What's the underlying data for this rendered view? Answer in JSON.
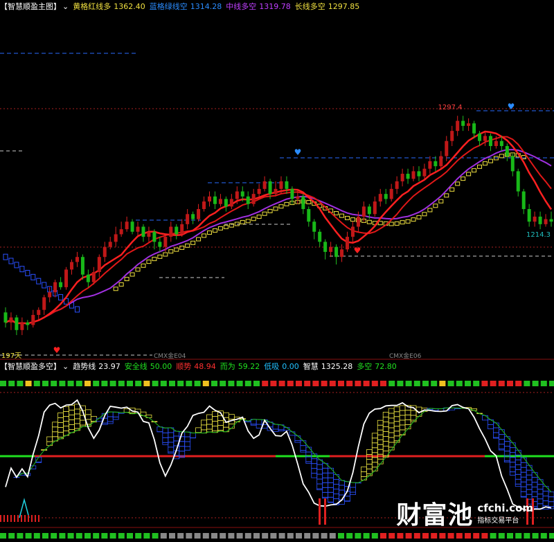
{
  "main_panel": {
    "title": "【智慧顺盈主图】",
    "dropdown_glyph": "⌄",
    "indicators": [
      {
        "label": "黄格红线多",
        "value": "1362.40",
        "color": "#f0e040"
      },
      {
        "label": "蓝格绿线空",
        "value": "1314.28",
        "color": "#2a8cff"
      },
      {
        "label": "中线多空",
        "value": "1319.78",
        "color": "#c040ff"
      },
      {
        "label": "长线多空",
        "value": "1297.85",
        "color": "#f0e040"
      }
    ],
    "labels": {
      "high": "1297.4",
      "low": "1214.3",
      "period": "197天",
      "contract_a": "CMX金E04",
      "contract_b": "CMX金E06"
    }
  },
  "sub_panel": {
    "title": "【智慧顺盈多空】",
    "dropdown_glyph": "⌄",
    "indicators": [
      {
        "label": "趋势线",
        "value": "23.97",
        "color": "#ffffff"
      },
      {
        "label": "安全线",
        "value": "50.00",
        "color": "#20e020"
      },
      {
        "label": "顺势",
        "value": "48.94",
        "color": "#ff3030"
      },
      {
        "label": "而为",
        "value": "59.22",
        "color": "#20e020"
      },
      {
        "label": "低吸",
        "value": "0.00",
        "color": "#20c0ff"
      },
      {
        "label": "智慧",
        "value": "1325.28",
        "color": "#ffffff"
      },
      {
        "label": "多空",
        "value": "72.80",
        "color": "#20e020"
      }
    ]
  },
  "watermark": {
    "brand": "财富池",
    "domain": "cfchi.com",
    "tagline": "指标交易平台"
  },
  "chart_data": {
    "type": "candlestick",
    "y_label_points": {
      "high": 1297.4,
      "low": 1214.3
    },
    "candles": [
      [
        1240,
        1236,
        1242,
        1234
      ],
      [
        1236,
        1238,
        1240,
        1233
      ],
      [
        1238,
        1233,
        1239,
        1231
      ],
      [
        1233,
        1236,
        1238,
        1231
      ],
      [
        1236,
        1235,
        1237,
        1233
      ],
      [
        1235,
        1239,
        1241,
        1234
      ],
      [
        1239,
        1241,
        1242,
        1237
      ],
      [
        1241,
        1246,
        1247,
        1239
      ],
      [
        1246,
        1248,
        1250,
        1244
      ],
      [
        1248,
        1252,
        1253,
        1246
      ],
      [
        1252,
        1250,
        1254,
        1249
      ],
      [
        1250,
        1257,
        1258,
        1249
      ],
      [
        1257,
        1260,
        1261,
        1255
      ],
      [
        1260,
        1262,
        1264,
        1258
      ],
      [
        1262,
        1255,
        1263,
        1253
      ],
      [
        1255,
        1252,
        1257,
        1250
      ],
      [
        1252,
        1256,
        1258,
        1251
      ],
      [
        1256,
        1262,
        1263,
        1254
      ],
      [
        1262,
        1266,
        1268,
        1260
      ],
      [
        1266,
        1268,
        1270,
        1265
      ],
      [
        1268,
        1271,
        1274,
        1266
      ],
      [
        1271,
        1273,
        1276,
        1270
      ],
      [
        1273,
        1276,
        1278,
        1272
      ],
      [
        1276,
        1272,
        1277,
        1271
      ],
      [
        1272,
        1274,
        1276,
        1270
      ],
      [
        1274,
        1270,
        1275,
        1268
      ],
      [
        1270,
        1272,
        1274,
        1268
      ],
      [
        1272,
        1268,
        1273,
        1265
      ],
      [
        1268,
        1266,
        1270,
        1264
      ],
      [
        1266,
        1270,
        1271,
        1264
      ],
      [
        1270,
        1274,
        1276,
        1268
      ],
      [
        1274,
        1271,
        1275,
        1269
      ],
      [
        1271,
        1275,
        1277,
        1270
      ],
      [
        1275,
        1279,
        1281,
        1273
      ],
      [
        1279,
        1277,
        1280,
        1275
      ],
      [
        1277,
        1281,
        1283,
        1276
      ],
      [
        1281,
        1284,
        1286,
        1280
      ],
      [
        1284,
        1286,
        1288,
        1282
      ],
      [
        1286,
        1283,
        1288,
        1281
      ],
      [
        1283,
        1285,
        1287,
        1282
      ],
      [
        1285,
        1282,
        1286,
        1280
      ],
      [
        1282,
        1285,
        1287,
        1281
      ],
      [
        1285,
        1288,
        1290,
        1283
      ],
      [
        1288,
        1286,
        1290,
        1284
      ],
      [
        1286,
        1283,
        1288,
        1281
      ],
      [
        1283,
        1287,
        1289,
        1282
      ],
      [
        1287,
        1289,
        1291,
        1286
      ],
      [
        1289,
        1292,
        1294,
        1288
      ],
      [
        1292,
        1287,
        1293,
        1285
      ],
      [
        1287,
        1289,
        1292,
        1286
      ],
      [
        1289,
        1292,
        1294,
        1287
      ],
      [
        1292,
        1289,
        1294,
        1287
      ],
      [
        1289,
        1285,
        1290,
        1283
      ],
      [
        1285,
        1286,
        1289,
        1283
      ],
      [
        1286,
        1281,
        1287,
        1279
      ],
      [
        1281,
        1276,
        1282,
        1274
      ],
      [
        1276,
        1272,
        1277,
        1269
      ],
      [
        1272,
        1268,
        1273,
        1266
      ],
      [
        1268,
        1264,
        1269,
        1261
      ],
      [
        1264,
        1266,
        1268,
        1262
      ],
      [
        1266,
        1262,
        1267,
        1259
      ],
      [
        1262,
        1265,
        1267,
        1260
      ],
      [
        1265,
        1270,
        1272,
        1264
      ],
      [
        1270,
        1274,
        1276,
        1268
      ],
      [
        1274,
        1278,
        1280,
        1272
      ],
      [
        1278,
        1282,
        1284,
        1276
      ],
      [
        1282,
        1279,
        1283,
        1277
      ],
      [
        1279,
        1284,
        1286,
        1278
      ],
      [
        1284,
        1287,
        1289,
        1282
      ],
      [
        1287,
        1285,
        1289,
        1283
      ],
      [
        1285,
        1289,
        1291,
        1284
      ],
      [
        1289,
        1292,
        1294,
        1287
      ],
      [
        1292,
        1295,
        1297,
        1290
      ],
      [
        1295,
        1293,
        1297,
        1291
      ],
      [
        1293,
        1296,
        1298,
        1292
      ],
      [
        1296,
        1294,
        1298,
        1292
      ],
      [
        1294,
        1297,
        1299,
        1293
      ],
      [
        1297,
        1300,
        1302,
        1295
      ],
      [
        1300,
        1298,
        1302,
        1296
      ],
      [
        1298,
        1302,
        1304,
        1297
      ],
      [
        1302,
        1308,
        1310,
        1300
      ],
      [
        1308,
        1312,
        1314,
        1306
      ],
      [
        1312,
        1316,
        1318,
        1310
      ],
      [
        1316,
        1314,
        1318,
        1312
      ],
      [
        1314,
        1315,
        1317,
        1312
      ],
      [
        1315,
        1311,
        1316,
        1309
      ],
      [
        1311,
        1308,
        1312,
        1306
      ],
      [
        1308,
        1310,
        1312,
        1306
      ],
      [
        1310,
        1306,
        1311,
        1304
      ],
      [
        1306,
        1308,
        1310,
        1305
      ],
      [
        1308,
        1306,
        1310,
        1304
      ],
      [
        1306,
        1302,
        1307,
        1300
      ],
      [
        1302,
        1296,
        1303,
        1294
      ],
      [
        1296,
        1288,
        1297,
        1286
      ],
      [
        1288,
        1281,
        1289,
        1279
      ],
      [
        1281,
        1276,
        1283,
        1274
      ],
      [
        1276,
        1278,
        1280,
        1274
      ],
      [
        1278,
        1275,
        1280,
        1273
      ],
      [
        1275,
        1277,
        1279,
        1274
      ],
      [
        1277,
        1276,
        1280,
        1274
      ]
    ]
  }
}
